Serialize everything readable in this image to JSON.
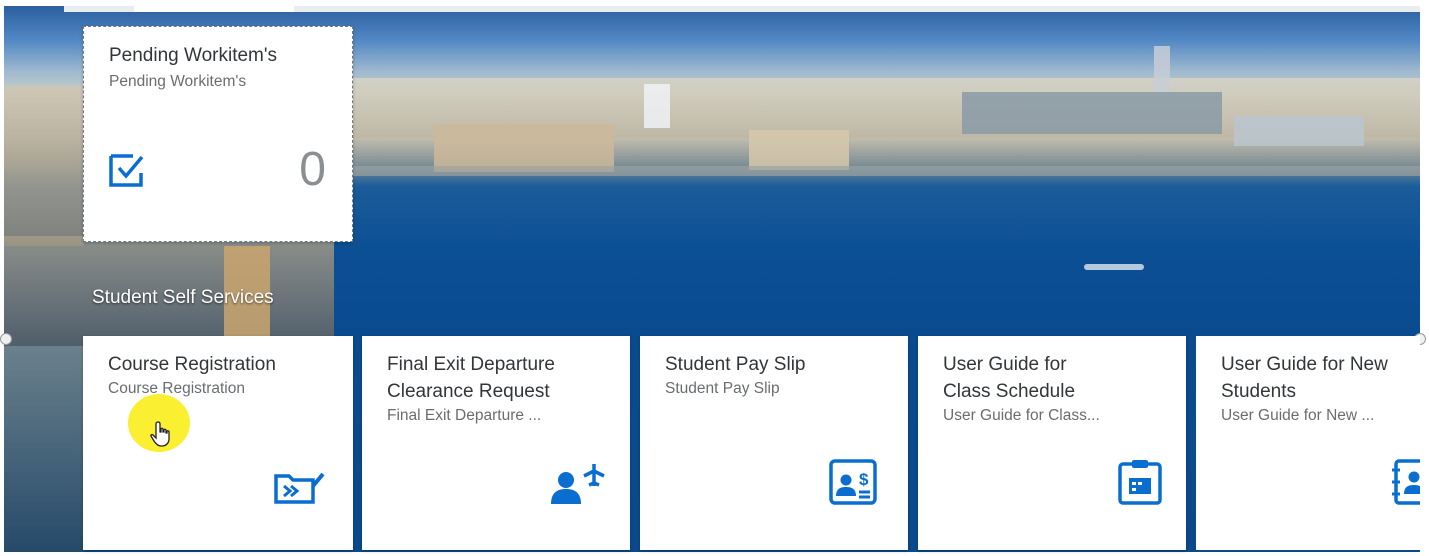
{
  "workitem_tile": {
    "title": "Pending Workitem's",
    "subtitle": "Pending Workitem's",
    "count": "0",
    "icon": "checkbox-icon"
  },
  "group": {
    "title": "Student Self Services"
  },
  "tiles": [
    {
      "title_line1": "Course Registration",
      "title_line2": "",
      "subtitle": "Course Registration",
      "icon": "course-registration-icon"
    },
    {
      "title_line1": "Final Exit Departure",
      "title_line2": "Clearance Request",
      "subtitle": "Final Exit Departure ...",
      "icon": "person-travel-icon"
    },
    {
      "title_line1": "Student Pay Slip",
      "title_line2": "",
      "subtitle": "Student Pay Slip",
      "icon": "pay-slip-icon"
    },
    {
      "title_line1": "User Guide for",
      "title_line2": "Class Schedule",
      "subtitle": "User Guide for Class...",
      "icon": "clipboard-icon"
    },
    {
      "title_line1": "User Guide for New",
      "title_line2": "Students",
      "subtitle": "User Guide for New ...",
      "icon": "contact-book-icon"
    }
  ],
  "colors": {
    "accent": "#0a6ed1",
    "tile_bg": "#ffffff",
    "title_text": "#32363a",
    "subtitle_text": "#6a6d70"
  }
}
